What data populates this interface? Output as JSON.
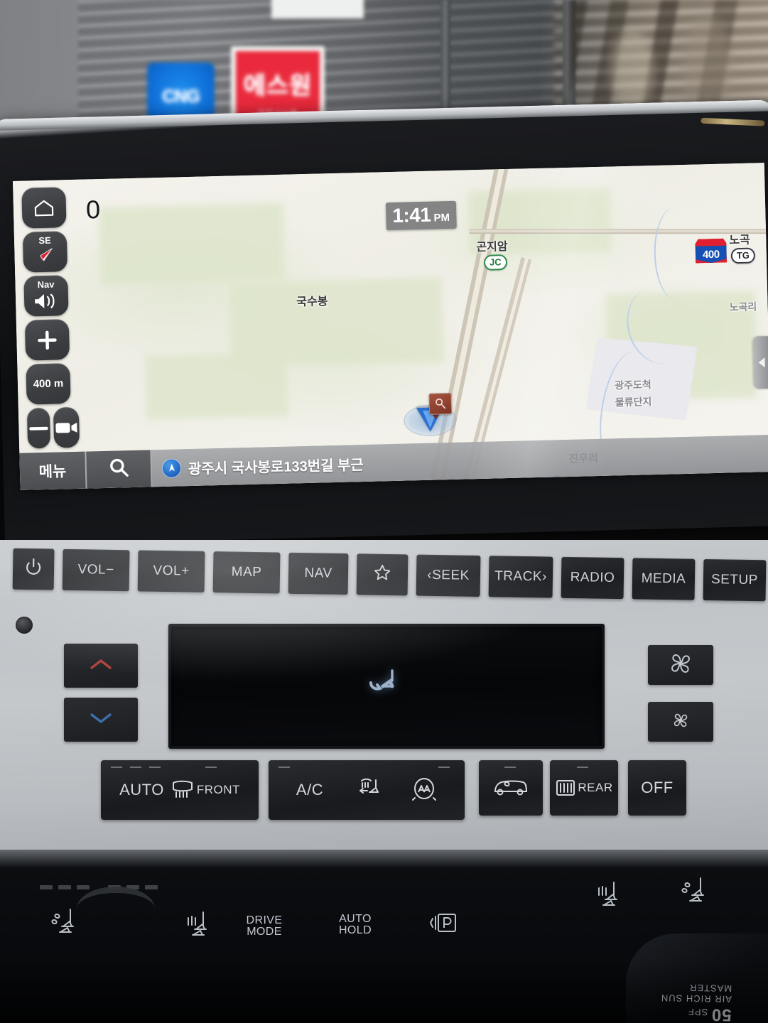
{
  "scene": {
    "cng_sign": "CNG",
    "security_sign": "에스원",
    "security_sub": "안전시스템"
  },
  "navigation": {
    "clock": {
      "time": "1:41",
      "meridiem": "PM"
    },
    "speed": "0",
    "scale_label": "400 m",
    "compass_heading": "SE",
    "nav_volume_label": "Nav",
    "menu_label": "메뉴",
    "current_address": "광주시 국사봉로133번길 부근",
    "region_label": "진우리",
    "icons": {
      "home": "home-icon",
      "compass": "compass-icon",
      "nav_volume": "speaker-icon",
      "zoom_in": "plus-icon",
      "zoom_out": "minus-icon",
      "dashcam": "video-camera-icon",
      "search": "search-icon",
      "position": "position-arrow-icon",
      "side_panel": "chevron-left-icon"
    },
    "map_labels": [
      {
        "text": "국수봉",
        "kind": "peak"
      },
      {
        "text": "곤지암",
        "kind": "junction"
      },
      {
        "text": "JC",
        "kind": "badge"
      },
      {
        "text": "400",
        "kind": "shield"
      },
      {
        "text": "노곡",
        "kind": "tollgate"
      },
      {
        "text": "TG",
        "kind": "badge"
      },
      {
        "text": "노곡리",
        "kind": "village"
      },
      {
        "text": "광주도척",
        "kind": "area"
      },
      {
        "text": "물류단지",
        "kind": "area"
      }
    ]
  },
  "head_unit_buttons": [
    {
      "name": "power",
      "label": "",
      "icon": "power-icon",
      "width": "w-pwr"
    },
    {
      "name": "volume-down",
      "label": "VOL−",
      "icon": "",
      "width": "w-std"
    },
    {
      "name": "volume-up",
      "label": "VOL+",
      "icon": "",
      "width": "w-std"
    },
    {
      "name": "map",
      "label": "MAP",
      "icon": "",
      "width": "w-std"
    },
    {
      "name": "nav",
      "label": "NAV",
      "icon": "",
      "width": "w-nav"
    },
    {
      "name": "favorite",
      "label": "",
      "icon": "star-icon",
      "width": "w-star"
    },
    {
      "name": "seek-back",
      "label": "‹SEEK",
      "icon": "",
      "width": "w-seek"
    },
    {
      "name": "track-forward",
      "label": "TRACK›",
      "icon": "",
      "width": "w-seek"
    },
    {
      "name": "radio",
      "label": "RADIO",
      "icon": "",
      "width": "w-src"
    },
    {
      "name": "media",
      "label": "MEDIA",
      "icon": "",
      "width": "w-src"
    },
    {
      "name": "setup",
      "label": "SETUP",
      "icon": "",
      "width": "w-src"
    }
  ],
  "climate": {
    "temp_up_icon": "chevron-up-icon",
    "temp_down_icon": "chevron-down-icon",
    "fan_up_icon": "fan-large-icon",
    "fan_down_icon": "fan-small-icon",
    "display_icon": "seat-airflow-icon",
    "buttons": [
      {
        "name": "auto",
        "label": "AUTO",
        "icon": ""
      },
      {
        "name": "front-defrost",
        "label": "FRONT",
        "icon": "front-defrost-icon"
      },
      {
        "name": "ac",
        "label": "A/C",
        "icon": ""
      },
      {
        "name": "mode",
        "label": "",
        "icon": "airflow-mode-icon"
      },
      {
        "name": "air-purifier",
        "label": "",
        "icon": "air-purifier-icon"
      },
      {
        "name": "recirculation",
        "label": "",
        "icon": "recirculation-icon"
      },
      {
        "name": "rear-defrost",
        "label": "REAR",
        "icon": "rear-defrost-icon"
      },
      {
        "name": "climate-off",
        "label": "OFF",
        "icon": ""
      }
    ]
  },
  "console": {
    "controls": [
      {
        "name": "driver-seat-ventilation",
        "label": "",
        "icon": "seat-ventilation-icon"
      },
      {
        "name": "driver-seat-heater",
        "label": "",
        "icon": "seat-heater-icon"
      },
      {
        "name": "drive-mode",
        "label": "DRIVE\nMODE",
        "label_l1": "DRIVE",
        "label_l2": "MODE",
        "icon": ""
      },
      {
        "name": "auto-hold",
        "label": "AUTO\nHOLD",
        "label_l1": "AUTO",
        "label_l2": "HOLD",
        "icon": ""
      },
      {
        "name": "electronic-parking-brake",
        "label": "",
        "icon": "parking-brake-icon"
      },
      {
        "name": "passenger-seat-heater",
        "label": "",
        "icon": "seat-heater-icon"
      },
      {
        "name": "passenger-seat-ventilation",
        "label": "",
        "icon": "seat-ventilation-icon"
      }
    ],
    "reflection": {
      "brand": "MASTER",
      "line": "AIR RICH SUN",
      "spf": "50",
      "spf_unit": "SPF"
    }
  },
  "colors": {
    "accent_blue": "#2a6fd0",
    "shield_red": "#e02030",
    "shield_blue": "#1450b4",
    "junction_green": "#2e8b4f",
    "map_bg": "#f1efe9",
    "fascia": "#c4c8cb",
    "button_dark": "#1d1f22"
  }
}
